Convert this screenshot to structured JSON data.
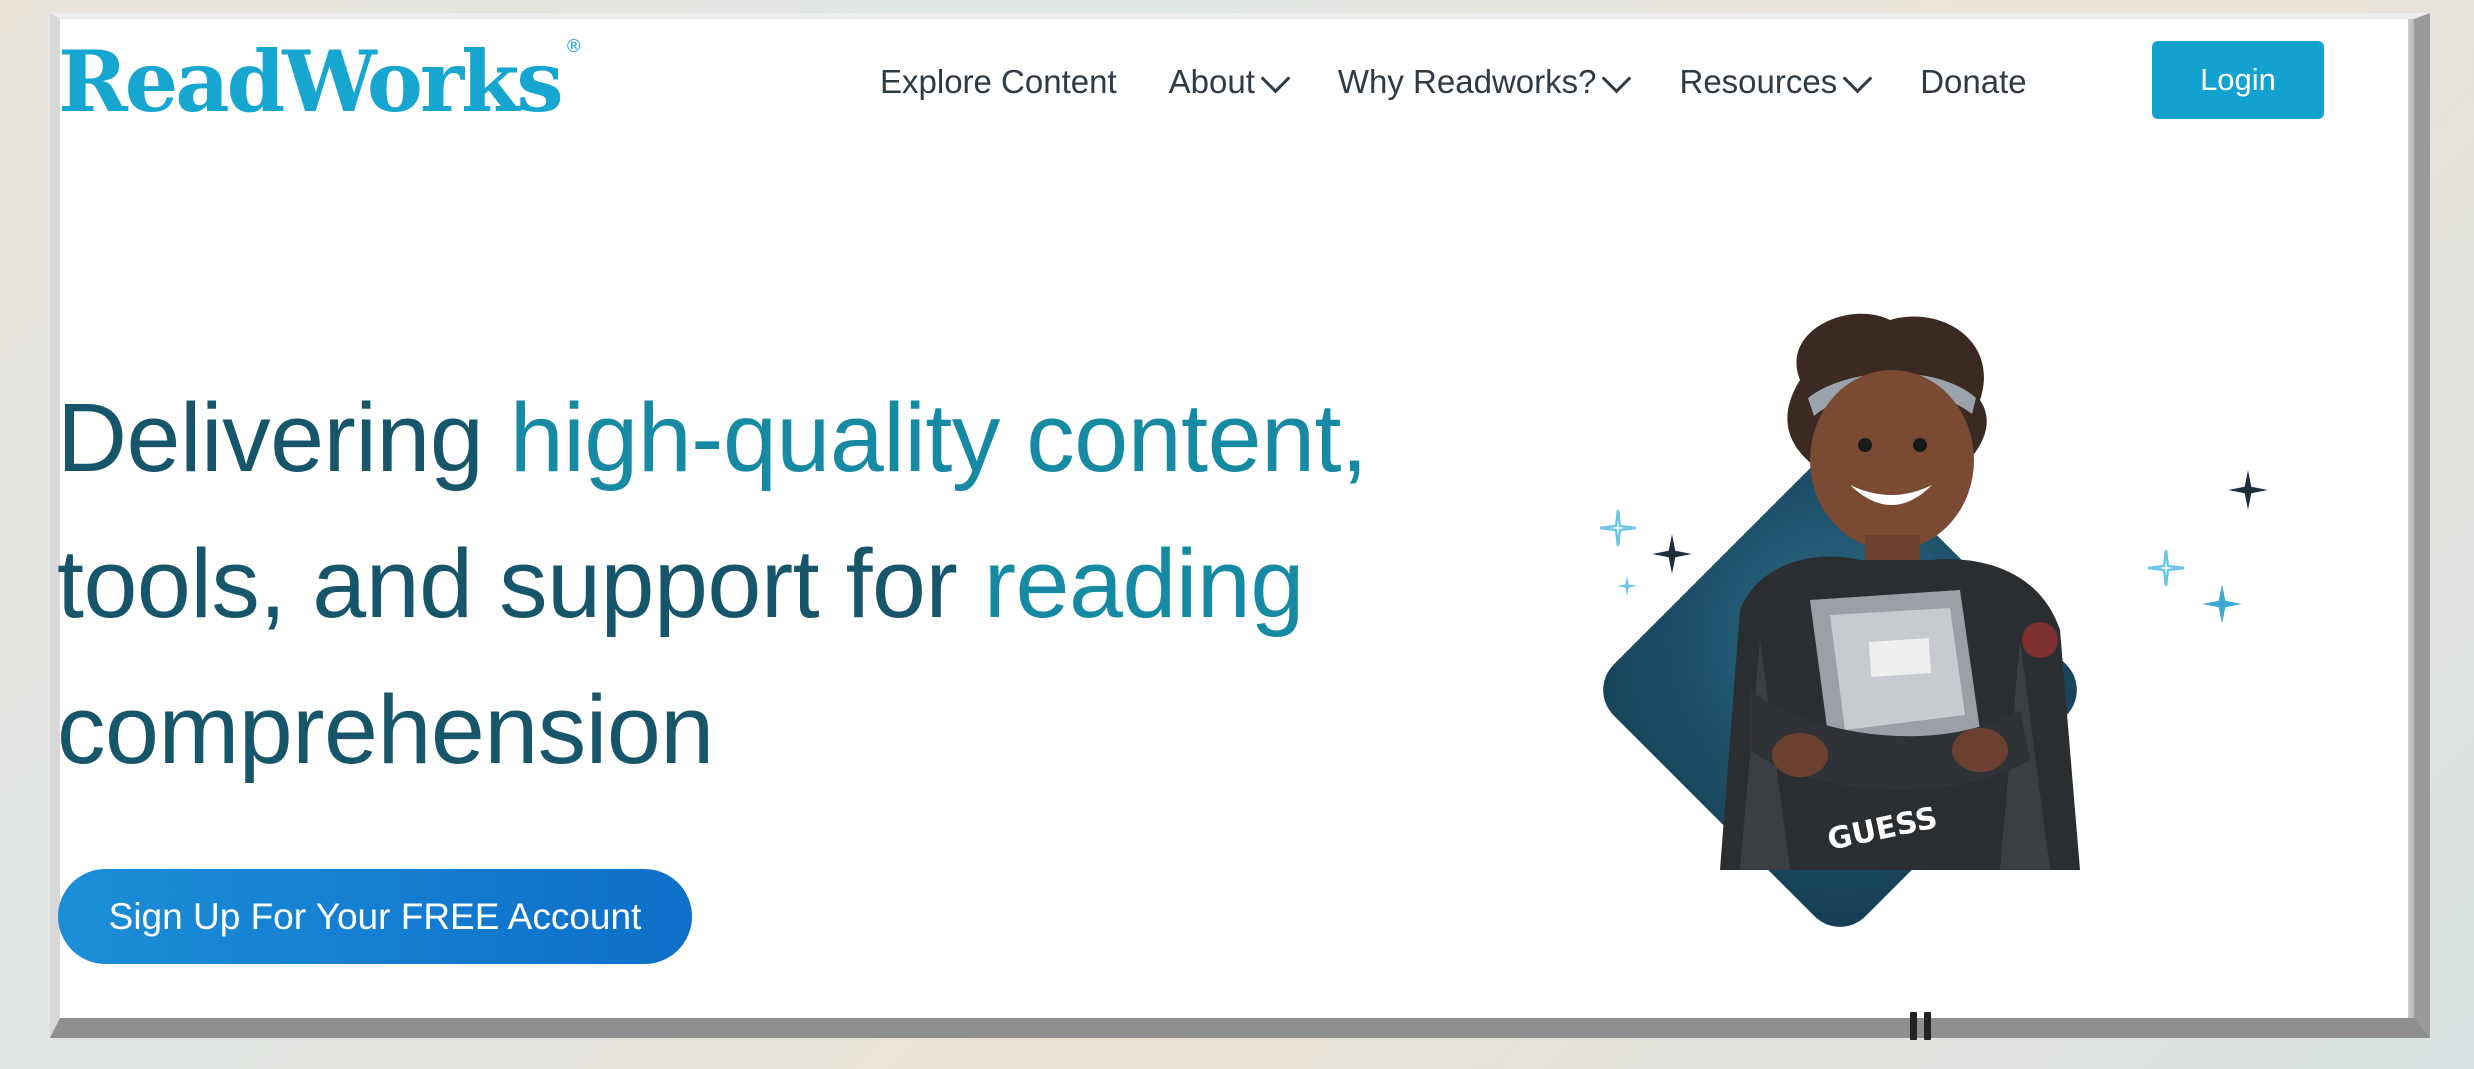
{
  "header": {
    "logo_text": "ReadWorks",
    "logo_reg": "®",
    "nav": [
      {
        "label": "Explore Content",
        "dropdown": false
      },
      {
        "label": "About",
        "dropdown": true
      },
      {
        "label": "Why Readworks?",
        "dropdown": true
      },
      {
        "label": "Resources",
        "dropdown": true
      },
      {
        "label": "Donate",
        "dropdown": false
      }
    ],
    "login_label": "Login"
  },
  "hero": {
    "headline_lines": [
      {
        "a": "Delivering ",
        "b": "high-quality content,"
      },
      {
        "a": "tools, and support for ",
        "b": "reading"
      },
      {
        "a": "comprehension",
        "b": ""
      }
    ],
    "cta_label": "Sign Up For Your FREE Account"
  },
  "colors": {
    "brand": "#17a6cf",
    "headline_dark": "#17556b",
    "headline_accent": "#168aa3",
    "cta": "#1c8ed8",
    "diamond": "#1c4e66"
  },
  "icons": {
    "chevron": "chevron-down-icon",
    "pause": "pause-icon",
    "sparkle": "sparkle-icon"
  }
}
